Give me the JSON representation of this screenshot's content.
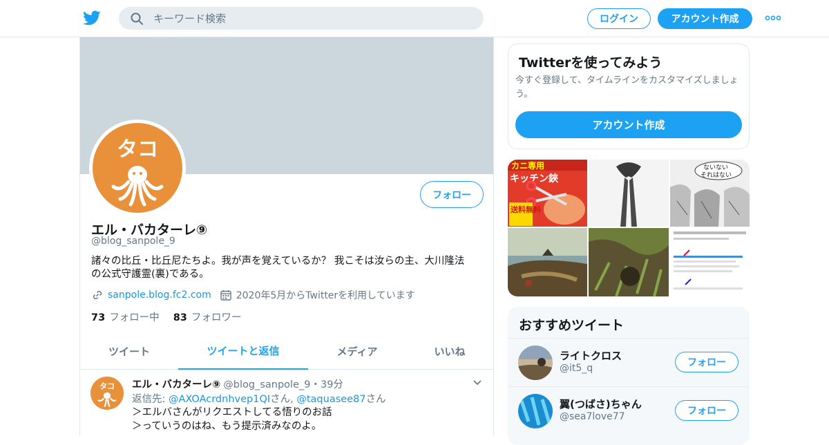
{
  "header": {
    "search_placeholder": "キーワード検索",
    "login_label": "ログイン",
    "signup_label": "アカウント作成"
  },
  "profile": {
    "name": "エル・バカターレ⑨",
    "handle": "@blog_sanpole_9",
    "follow_label": "フォロー",
    "bio_line1": "諸々の比丘・比丘尼たちよ。我が声を覚えているか？ 我こそは汝らの主、大川隆法",
    "bio_line2": "の公式守護霊(裏)である。",
    "url": "sanpole.blog.fc2.com",
    "joined": "2020年5月からTwitterを利用しています",
    "following_count": "73",
    "following_label": "フォロー中",
    "followers_count": "83",
    "followers_label": "フォロワー",
    "avatar_text": "タコ"
  },
  "tabs": [
    {
      "label": "ツイート"
    },
    {
      "label": "ツイートと返信"
    },
    {
      "label": "メディア"
    },
    {
      "label": "いいね"
    }
  ],
  "tweet": {
    "name": "エル・バカターレ⑨",
    "handle_time": "@blog_sanpole_9・39分",
    "reply_prefix": "返信先: ",
    "reply_user1": "@AXOAcrdnhvep1QI",
    "reply_mid": "さん, ",
    "reply_user2": "@taquasee87",
    "reply_suffix": "さん",
    "line1": "＞エルバさんがリクエストしてる悟りのお話",
    "line2": "＞っていうのはね、もう提示済みなのよ。"
  },
  "signup_card": {
    "title": "Twitterを使ってみよう",
    "desc": "今すぐ登録して、タイムラインをカスタマイズしましょう。",
    "cta": "アカウント作成"
  },
  "media": {
    "tile1_line1": "カニ専用",
    "tile1_line2": "キッチン鋏",
    "tile1_badge": "送料無料",
    "tile3_bubble1": "ないない",
    "tile3_bubble2": "それはない"
  },
  "recommendations": {
    "title": "おすすめツイート",
    "items": [
      {
        "name": "ライトクロス",
        "handle": "@it5_q",
        "follow": "フォロー"
      },
      {
        "name": "翼(つばさ)ちゃん",
        "handle": "@sea7love77",
        "follow": "フォロー"
      }
    ]
  },
  "colors": {
    "accent": "#1da1f2",
    "banner": "#ccd6dd",
    "avatar_orange": "#e8913a"
  },
  "icons": [
    "twitter-bird-icon",
    "search-icon",
    "more-dots-icon",
    "link-icon",
    "calendar-icon",
    "chevron-down-icon"
  ]
}
